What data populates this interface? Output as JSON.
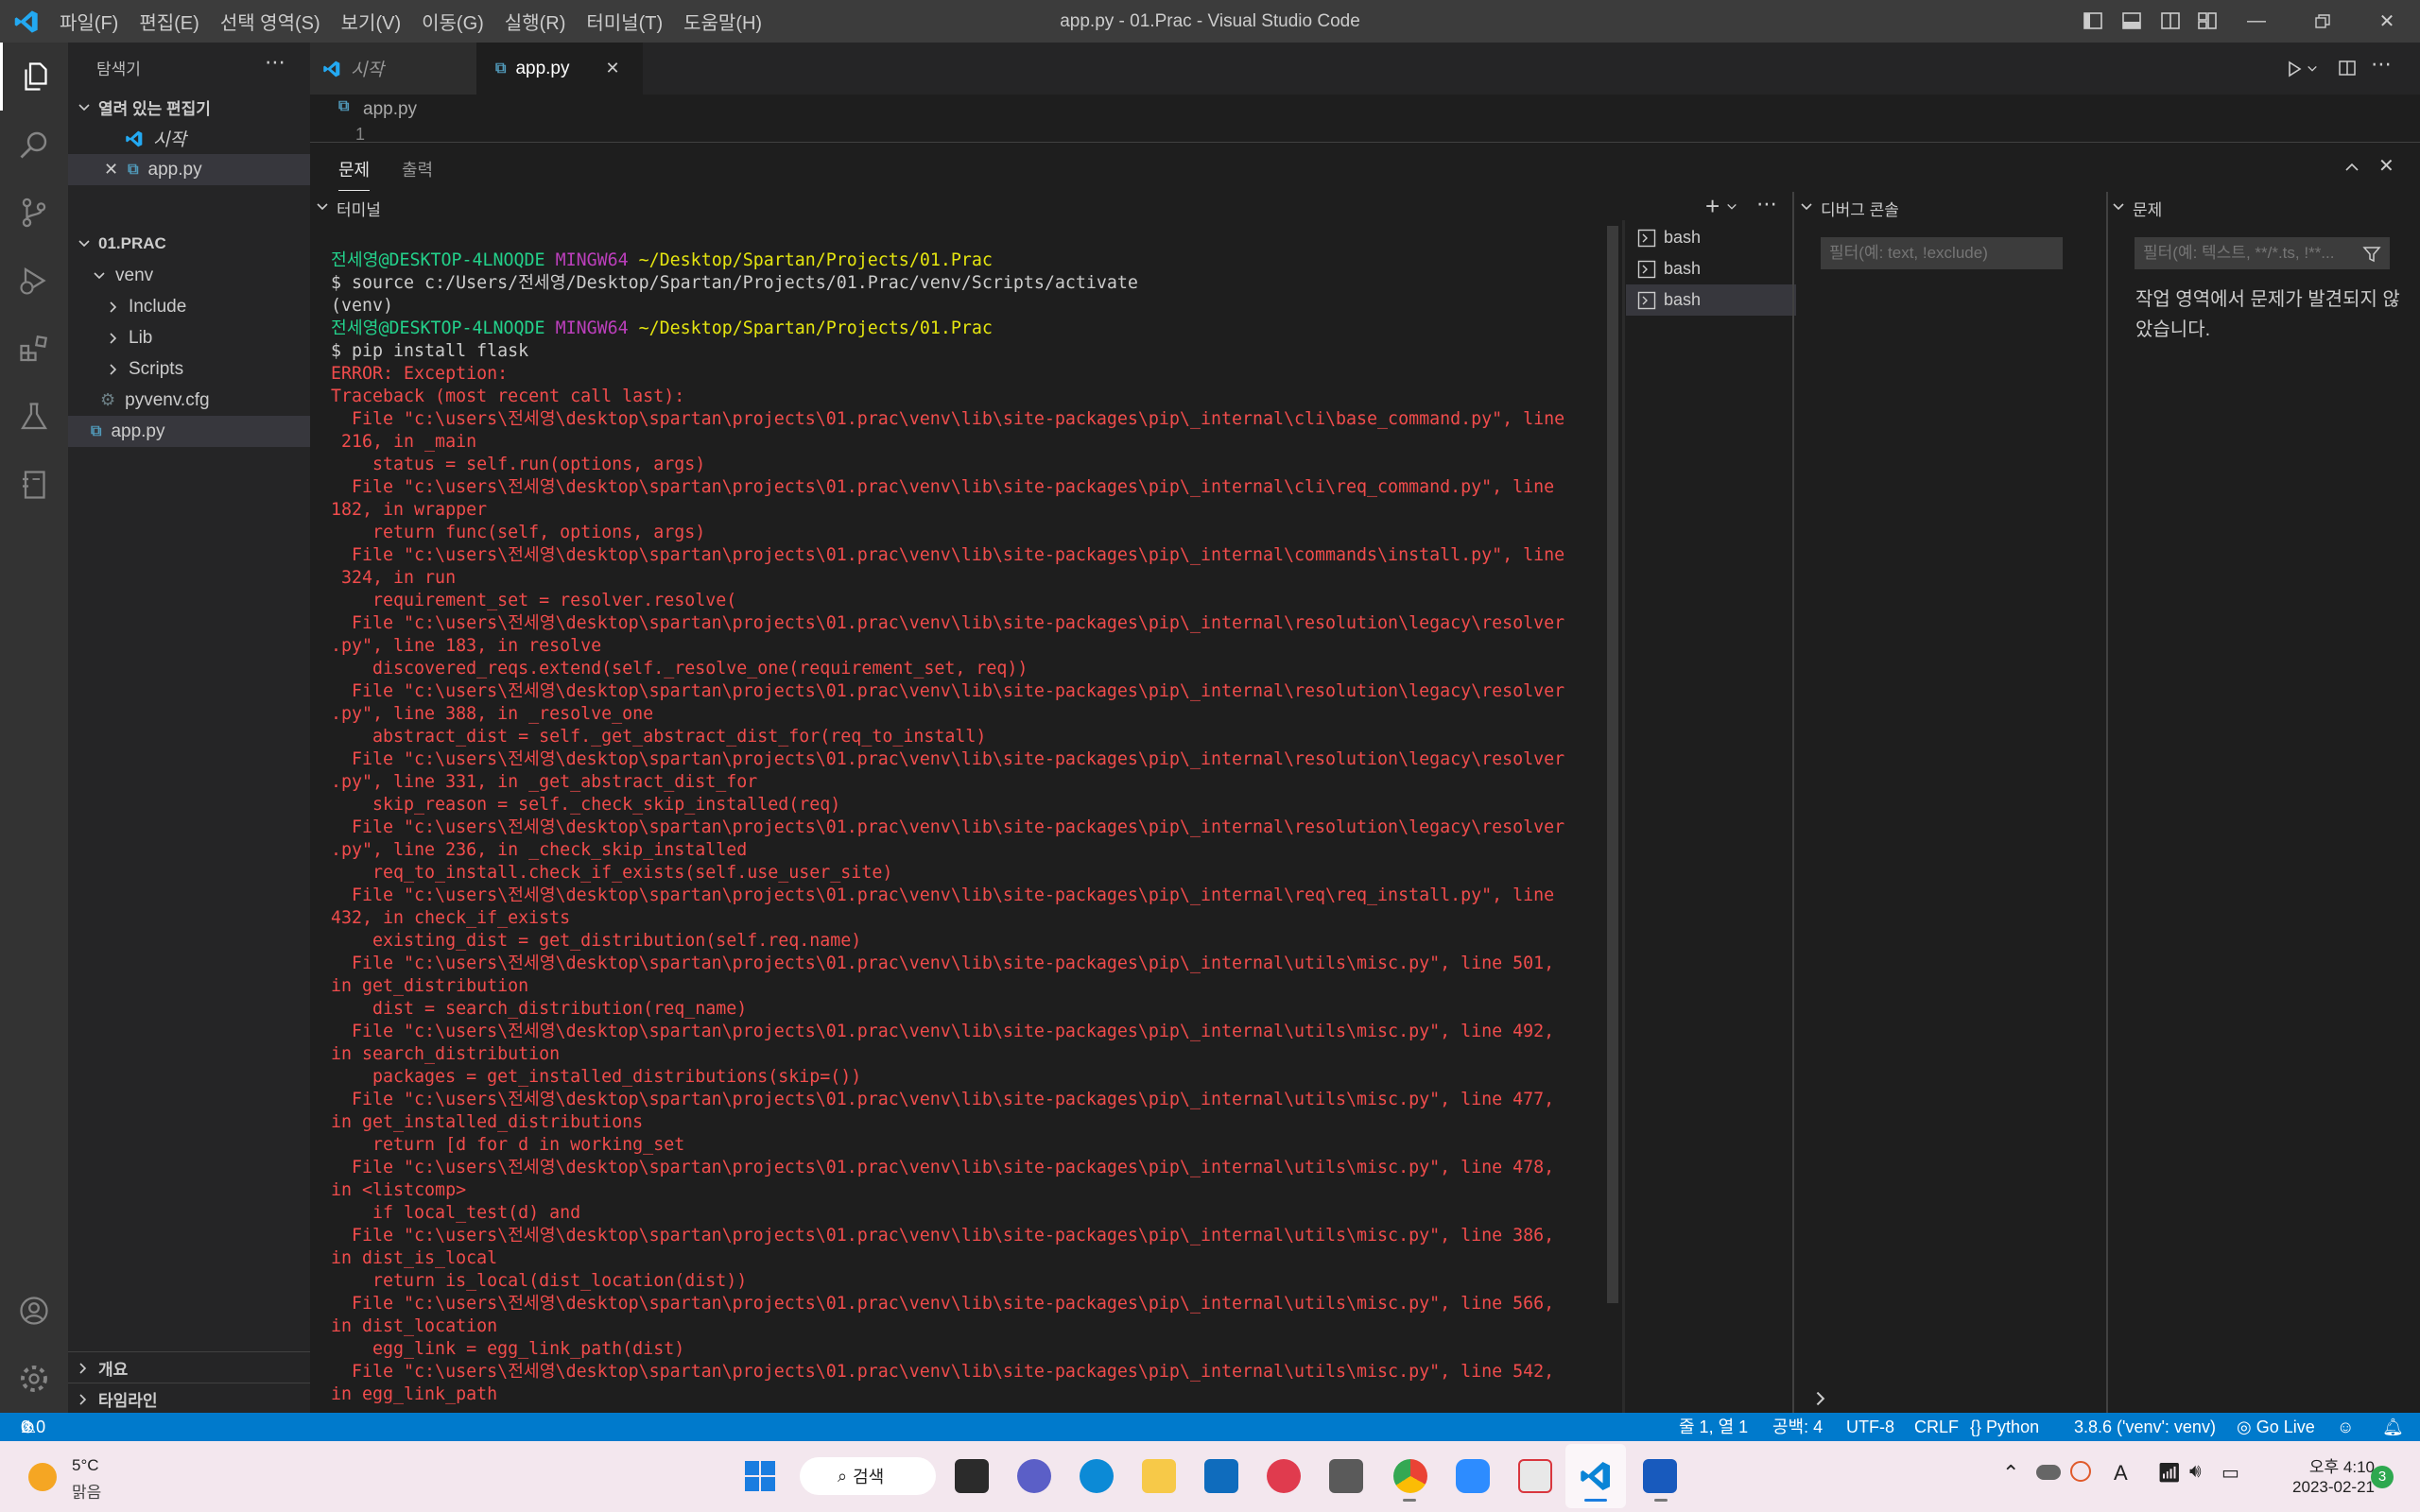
{
  "titlebar": {
    "menu": [
      "파일(F)",
      "편집(E)",
      "선택 영역(S)",
      "보기(V)",
      "이동(G)",
      "실행(R)",
      "터미널(T)",
      "도움말(H)"
    ],
    "window_title": "app.py - 01.Prac - Visual Studio Code"
  },
  "sidebar": {
    "header": "탐색기",
    "open_editors": {
      "label": "열려 있는 편집기",
      "items": [
        "시작",
        "app.py"
      ]
    },
    "folder": {
      "label": "01.PRAC",
      "venv": "venv",
      "venv_children": [
        "Include",
        "Lib",
        "Scripts"
      ],
      "files": [
        "pyvenv.cfg",
        "app.py"
      ]
    },
    "outline": "개요",
    "timeline": "타임라인"
  },
  "editor": {
    "tabs": [
      "시작",
      "app.py"
    ],
    "breadcrumb": "app.py",
    "line_number": "1"
  },
  "panel": {
    "tabs": [
      "문제",
      "출력"
    ],
    "terminal_header": "터미널",
    "terminal_sessions": [
      "bash",
      "bash",
      "bash"
    ],
    "debug_console_header": "디버그 콘솔",
    "debug_filter_placeholder": "필터(예: text, !exclude)",
    "problems_header": "문제",
    "problems_filter_placeholder": "필터(예: 텍스트, **/*.ts, !**...",
    "problems_message": "작업 영역에서 문제가 발견되지 않았습니다.",
    "terminal": {
      "prompt1_user": "전세영",
      "prompt1_host": "@DESKTOP-4LNOQDE",
      "prompt1_shell": "MINGW64",
      "prompt1_path": "~/Desktop/Spartan/Projects/01.Prac",
      "cmd1": "$ source c:/Users/전세영/Desktop/Spartan/Projects/01.Prac/venv/Scripts/activate",
      "venv": "(venv)",
      "prompt2_user": "전세영",
      "prompt2_host": "@DESKTOP-4LNOQDE",
      "prompt2_shell": "MINGW64",
      "prompt2_path": "~/Desktop/Spartan/Projects/01.Prac",
      "cmd2": "$ pip install flask",
      "error_lines": [
        "ERROR: Exception:",
        "Traceback (most recent call last):",
        "  File \"c:\\users\\전세영\\desktop\\spartan\\projects\\01.prac\\venv\\lib\\site-packages\\pip\\_internal\\cli\\base_command.py\", line",
        " 216, in _main",
        "    status = self.run(options, args)",
        "  File \"c:\\users\\전세영\\desktop\\spartan\\projects\\01.prac\\venv\\lib\\site-packages\\pip\\_internal\\cli\\req_command.py\", line",
        "182, in wrapper",
        "    return func(self, options, args)",
        "  File \"c:\\users\\전세영\\desktop\\spartan\\projects\\01.prac\\venv\\lib\\site-packages\\pip\\_internal\\commands\\install.py\", line",
        " 324, in run",
        "    requirement_set = resolver.resolve(",
        "  File \"c:\\users\\전세영\\desktop\\spartan\\projects\\01.prac\\venv\\lib\\site-packages\\pip\\_internal\\resolution\\legacy\\resolver",
        ".py\", line 183, in resolve",
        "    discovered_reqs.extend(self._resolve_one(requirement_set, req))",
        "  File \"c:\\users\\전세영\\desktop\\spartan\\projects\\01.prac\\venv\\lib\\site-packages\\pip\\_internal\\resolution\\legacy\\resolver",
        ".py\", line 388, in _resolve_one",
        "    abstract_dist = self._get_abstract_dist_for(req_to_install)",
        "  File \"c:\\users\\전세영\\desktop\\spartan\\projects\\01.prac\\venv\\lib\\site-packages\\pip\\_internal\\resolution\\legacy\\resolver",
        ".py\", line 331, in _get_abstract_dist_for",
        "    skip_reason = self._check_skip_installed(req)",
        "  File \"c:\\users\\전세영\\desktop\\spartan\\projects\\01.prac\\venv\\lib\\site-packages\\pip\\_internal\\resolution\\legacy\\resolver",
        ".py\", line 236, in _check_skip_installed",
        "    req_to_install.check_if_exists(self.use_user_site)",
        "  File \"c:\\users\\전세영\\desktop\\spartan\\projects\\01.prac\\venv\\lib\\site-packages\\pip\\_internal\\req\\req_install.py\", line",
        "432, in check_if_exists",
        "    existing_dist = get_distribution(self.req.name)",
        "  File \"c:\\users\\전세영\\desktop\\spartan\\projects\\01.prac\\venv\\lib\\site-packages\\pip\\_internal\\utils\\misc.py\", line 501,",
        "in get_distribution",
        "    dist = search_distribution(req_name)",
        "  File \"c:\\users\\전세영\\desktop\\spartan\\projects\\01.prac\\venv\\lib\\site-packages\\pip\\_internal\\utils\\misc.py\", line 492,",
        "in search_distribution",
        "    packages = get_installed_distributions(skip=())",
        "  File \"c:\\users\\전세영\\desktop\\spartan\\projects\\01.prac\\venv\\lib\\site-packages\\pip\\_internal\\utils\\misc.py\", line 477,",
        "in get_installed_distributions",
        "    return [d for d in working_set",
        "  File \"c:\\users\\전세영\\desktop\\spartan\\projects\\01.prac\\venv\\lib\\site-packages\\pip\\_internal\\utils\\misc.py\", line 478,",
        "in <listcomp>",
        "    if local_test(d) and",
        "  File \"c:\\users\\전세영\\desktop\\spartan\\projects\\01.prac\\venv\\lib\\site-packages\\pip\\_internal\\utils\\misc.py\", line 386,",
        "in dist_is_local",
        "    return is_local(dist_location(dist))",
        "  File \"c:\\users\\전세영\\desktop\\spartan\\projects\\01.prac\\venv\\lib\\site-packages\\pip\\_internal\\utils\\misc.py\", line 566,",
        "in dist_location",
        "    egg_link = egg_link_path(dist)",
        "  File \"c:\\users\\전세영\\desktop\\spartan\\projects\\01.prac\\venv\\lib\\site-packages\\pip\\_internal\\utils\\misc.py\", line 542,",
        "in egg_link_path"
      ]
    }
  },
  "statusbar": {
    "problems": "0",
    "warnings": "0",
    "cursor": "줄 1, 열 1",
    "spaces": "공백: 4",
    "encoding": "UTF-8",
    "eol": "CRLF",
    "language": "Python",
    "interpreter": "3.8.6 ('venv': venv)",
    "golive": "Go Live"
  },
  "taskbar": {
    "weather_temp": "5°C",
    "weather_desc": "맑음",
    "search_label": "검색",
    "time": "오후 4:10",
    "date": "2023-02-21",
    "notification_count": "3",
    "ime": "A"
  },
  "colors": {
    "accent": "#007acc",
    "terminal_error": "#f14c4c",
    "prompt_user": "#23d18b",
    "prompt_host": "#bc3fbc",
    "prompt_path": "#e5e510"
  }
}
